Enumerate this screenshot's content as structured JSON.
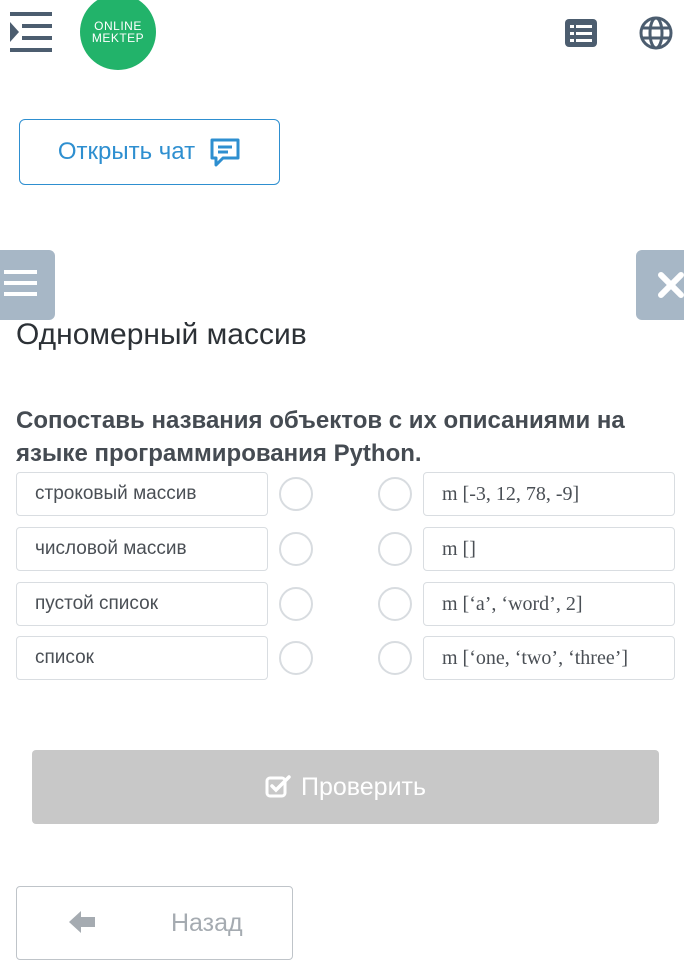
{
  "header": {
    "logo_line1": "ONLINE",
    "logo_line2": "MEKTEP",
    "menu_icon": "indent-menu-icon",
    "list_icon": "list-icon",
    "language_icon": "globe-icon"
  },
  "chat": {
    "label": "Открыть чат",
    "icon": "chat-icon"
  },
  "lesson": {
    "title": "Одномерный массив",
    "instruction": "Сопоставь названия объектов с их описаниями на языке программирования Python."
  },
  "matching": {
    "left": [
      "строковый массив",
      "числовой массив",
      "пустой список",
      "список"
    ],
    "right": [
      "m [-3, 12, 78, -9]",
      "m []",
      "m [‘a’, ‘word’, 2]",
      "m [‘one, ‘two’, ‘three’]"
    ]
  },
  "actions": {
    "check_label": "Проверить",
    "back_label": "Назад"
  },
  "colors": {
    "accent": "#2e8fd0",
    "logo": "#22b36a",
    "side_tab": "#a7b7c6",
    "disabled_button": "#c8c8c8"
  }
}
